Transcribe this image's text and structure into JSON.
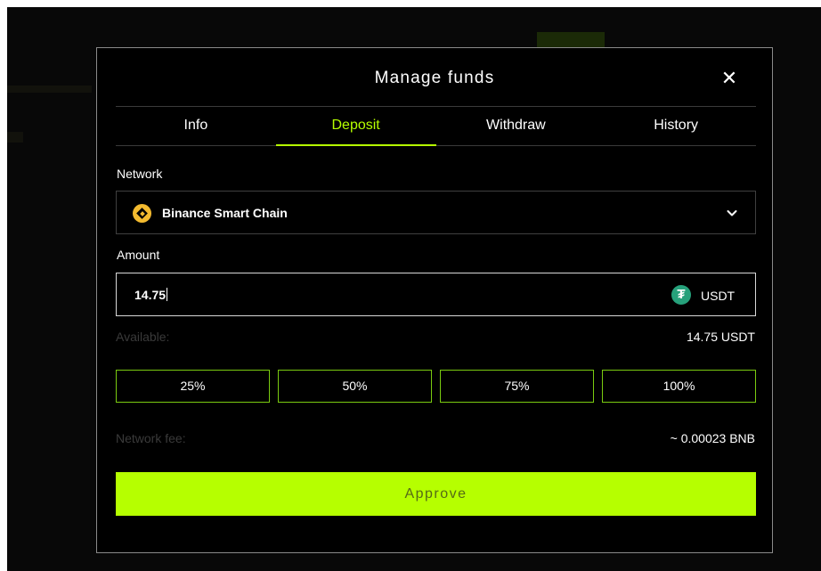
{
  "modal": {
    "title": "Manage funds",
    "close_symbol": "✕",
    "tabs": [
      "Info",
      "Deposit",
      "Withdraw",
      "History"
    ],
    "active_tab": "Deposit"
  },
  "network": {
    "label": "Network",
    "selected": "Binance Smart Chain",
    "icon": "bnb-icon"
  },
  "amount": {
    "label": "Amount",
    "value": "14.75",
    "currency": "USDT",
    "icon": "usdt-icon",
    "icon_glyph": "₮"
  },
  "available": {
    "label": "Available:",
    "value": "14.75 USDT"
  },
  "percentages": [
    "25%",
    "50%",
    "75%",
    "100%"
  ],
  "fee": {
    "label": "Network fee:",
    "value": "~ 0.00023 BNB"
  },
  "approve_label": "Approve",
  "colors": {
    "accent": "#b6ff00",
    "background": "#000000",
    "usdt": "#26a17b",
    "bnb": "#f3ba2f"
  }
}
